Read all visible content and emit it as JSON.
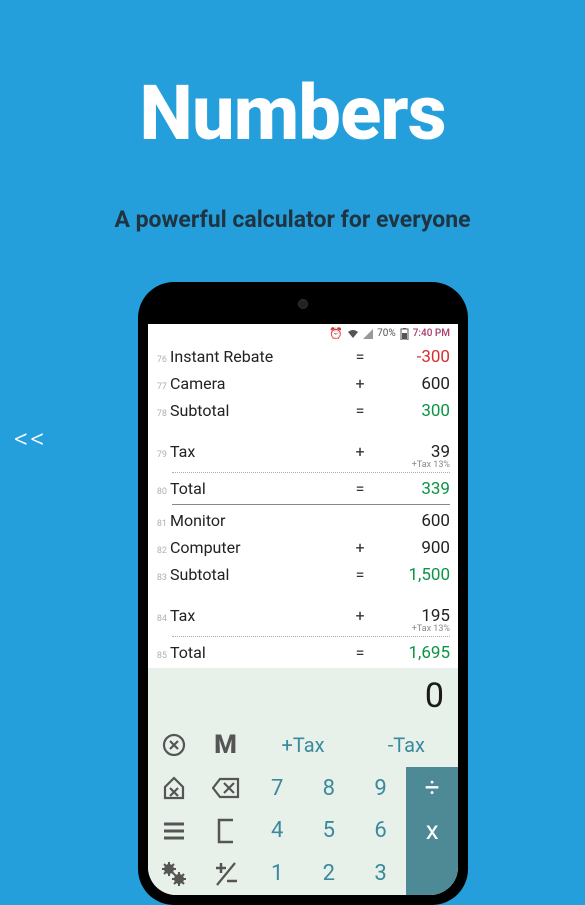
{
  "hero": {
    "title": "Numbers",
    "subtitle": "A powerful calculator for everyone"
  },
  "nav": {
    "prev": "<<"
  },
  "status": {
    "battery": "70%",
    "time": "7:40 PM"
  },
  "history": [
    {
      "ln": "76",
      "label": "Instant Rebate",
      "op": "=",
      "val": "-300",
      "color": "red"
    },
    {
      "ln": "77",
      "label": "Camera",
      "op": "+",
      "val": "600"
    },
    {
      "ln": "78",
      "label": "Subtotal",
      "op": "=",
      "val": "300",
      "color": "green"
    },
    {
      "gap": true
    },
    {
      "ln": "79",
      "label": "Tax",
      "op": "+",
      "val": "39",
      "note": "+Tax 13%"
    },
    {
      "hr": "dotted"
    },
    {
      "ln": "80",
      "label": "Total",
      "op": "=",
      "val": "339",
      "color": "green"
    },
    {
      "hr": "solid"
    },
    {
      "ln": "81",
      "label": "Monitor",
      "op": "",
      "val": "600"
    },
    {
      "ln": "82",
      "label": "Computer",
      "op": "+",
      "val": "900"
    },
    {
      "ln": "83",
      "label": "Subtotal",
      "op": "=",
      "val": "1,500",
      "color": "green"
    },
    {
      "gap": true
    },
    {
      "ln": "84",
      "label": "Tax",
      "op": "+",
      "val": "195",
      "note": "+Tax 13%"
    },
    {
      "hr": "dotted"
    },
    {
      "ln": "85",
      "label": "Total",
      "op": "=",
      "val": "1,695",
      "color": "green"
    }
  ],
  "display": "0",
  "keypad": {
    "tax_plus": "+Tax",
    "tax_minus": "-Tax",
    "mem": "M",
    "k7": "7",
    "k8": "8",
    "k9": "9",
    "k4": "4",
    "k5": "5",
    "k6": "6",
    "k1": "1",
    "k2": "2",
    "k3": "3",
    "div": "÷",
    "mul": "x"
  }
}
